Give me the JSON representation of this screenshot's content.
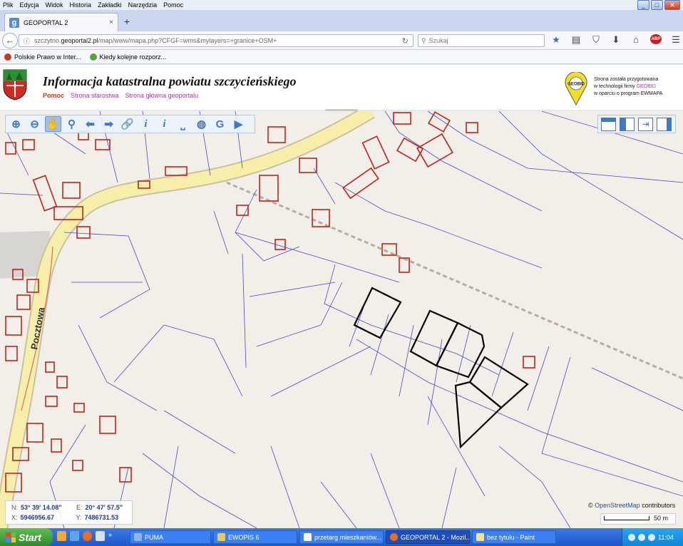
{
  "browser": {
    "menu": [
      "Plik",
      "Edycja",
      "Widok",
      "Historia",
      "Zakładki",
      "Narzędzia",
      "Pomoc"
    ],
    "window_buttons": [
      "_",
      "□",
      "✕"
    ],
    "tab_title": "GEOPORTAL 2",
    "tab_close": "×",
    "new_tab": "+",
    "url_prefix": "szczytno.",
    "url_domain": "geoportal2.pl",
    "url_rest": "/map/www/mapa.php?CFGF=wms&mylayers=+granice+OSM+",
    "search_placeholder": "Szukaj",
    "abp_label": "ABP",
    "bookmarks": [
      "Polskie Prawo w Inter...",
      "Kiedy kolejne rozporz..."
    ]
  },
  "page": {
    "title": "Informacja katastralna powiatu szczycieńskiego",
    "links": [
      "Pomoc",
      "Strona starostwa",
      "Strona główna geoportalu"
    ],
    "geobid_logo": "GEOBID",
    "geobid_line1": "Strona została przygotowana",
    "geobid_line2a": "w technologii firmy ",
    "geobid_line2b": "GEOBID",
    "geobid_line3": "w oparciu o program EWMAPA"
  },
  "map": {
    "street_label": "Pocztowa",
    "coords": {
      "n_label": "N:",
      "n_value": "53° 39' 14.08\"",
      "e_label": "E:",
      "e_value": "20° 47' 57.5\"",
      "x_label": "X:",
      "x_value": "5946956.67",
      "y_label": "Y:",
      "y_value": "7486731.53"
    },
    "attribution_symbol": "©",
    "attribution_link": "OpenStreetMap",
    "attribution_rest": " contributors",
    "scale_label": "50 m",
    "colors": {
      "building": "#c0211c",
      "parcel": "#3a3ab8",
      "road": "#f7efa9",
      "highlight": "#000000",
      "background": "#f2efe9"
    }
  },
  "taskbar": {
    "start_label": "Start",
    "tasks": [
      "PUMA",
      "EWOPIS 6",
      "przetarg mieszkaniów...",
      "GEOPORTAL 2 - Mozil...",
      "bez tytułu - Paint"
    ],
    "clock": "11:04"
  }
}
